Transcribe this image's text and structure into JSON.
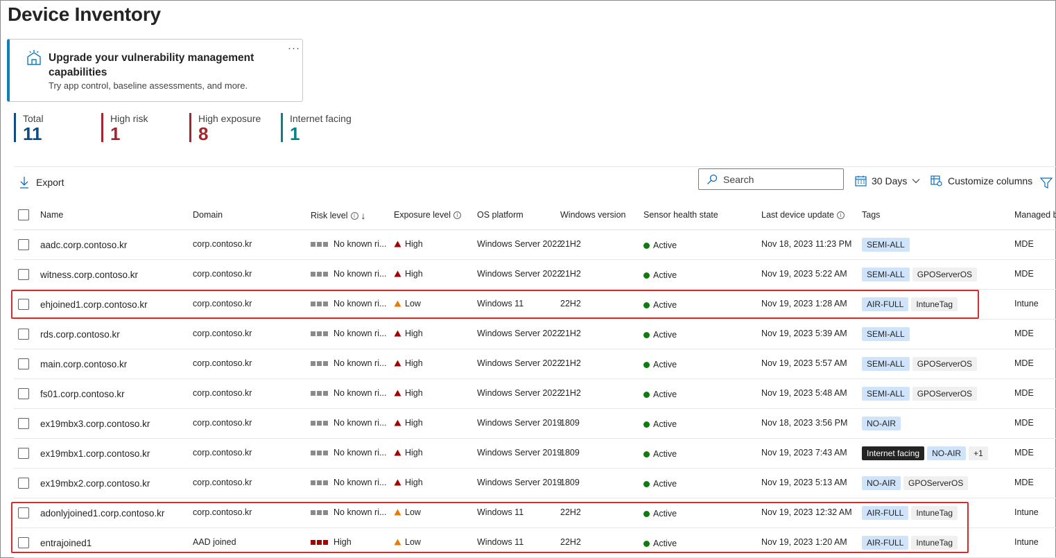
{
  "page": {
    "title": "Device Inventory"
  },
  "card": {
    "title": "Upgrade your vulnerability management capabilities",
    "subtitle": "Try app control, baseline assessments, and more.",
    "more": "···"
  },
  "stats": [
    {
      "label": "Total",
      "value": "11",
      "color": "#0f4c81"
    },
    {
      "label": "High risk",
      "value": "1",
      "color": "#a4262c"
    },
    {
      "label": "High exposure",
      "value": "8",
      "color": "#a4262c"
    },
    {
      "label": "Internet facing",
      "value": "1",
      "color": "#038387"
    }
  ],
  "toolbar": {
    "export_label": "Export",
    "search_placeholder": "Search",
    "days_label": "30 Days",
    "customize_label": "Customize columns"
  },
  "columns": {
    "name": "Name",
    "domain": "Domain",
    "risk": "Risk level",
    "exposure": "Exposure level",
    "os": "OS platform",
    "winver": "Windows version",
    "health": "Sensor health state",
    "lastupdate": "Last device update",
    "tags": "Tags",
    "managed": "Managed b"
  },
  "rows": [
    {
      "name": "aadc.corp.contoso.kr",
      "domain": "corp.contoso.kr",
      "risk": "No known ri...",
      "risk_high": false,
      "exposure": "High",
      "os": "Windows Server 2022",
      "winver": "21H2",
      "health": "Active",
      "updated": "Nov 18, 2023 11:23 PM",
      "tags": [
        {
          "t": "SEMI-ALL",
          "s": "blue"
        }
      ],
      "managed": "MDE"
    },
    {
      "name": "witness.corp.contoso.kr",
      "domain": "corp.contoso.kr",
      "risk": "No known ri...",
      "risk_high": false,
      "exposure": "High",
      "os": "Windows Server 2022",
      "winver": "21H2",
      "health": "Active",
      "updated": "Nov 19, 2023 5:22 AM",
      "tags": [
        {
          "t": "SEMI-ALL",
          "s": "blue"
        },
        {
          "t": "GPOServerOS",
          "s": "gray"
        }
      ],
      "managed": "MDE"
    },
    {
      "name": "ehjoined1.corp.contoso.kr",
      "domain": "corp.contoso.kr",
      "risk": "No known ri...",
      "risk_high": false,
      "exposure": "Low",
      "os": "Windows 11",
      "winver": "22H2",
      "health": "Active",
      "updated": "Nov 19, 2023 1:28 AM",
      "tags": [
        {
          "t": "AIR-FULL",
          "s": "blue"
        },
        {
          "t": "IntuneTag",
          "s": "gray"
        }
      ],
      "managed": "Intune"
    },
    {
      "name": "rds.corp.contoso.kr",
      "domain": "corp.contoso.kr",
      "risk": "No known ri...",
      "risk_high": false,
      "exposure": "High",
      "os": "Windows Server 2022",
      "winver": "21H2",
      "health": "Active",
      "updated": "Nov 19, 2023 5:39 AM",
      "tags": [
        {
          "t": "SEMI-ALL",
          "s": "blue"
        }
      ],
      "managed": "MDE"
    },
    {
      "name": "main.corp.contoso.kr",
      "domain": "corp.contoso.kr",
      "risk": "No known ri...",
      "risk_high": false,
      "exposure": "High",
      "os": "Windows Server 2022",
      "winver": "21H2",
      "health": "Active",
      "updated": "Nov 19, 2023 5:57 AM",
      "tags": [
        {
          "t": "SEMI-ALL",
          "s": "blue"
        },
        {
          "t": "GPOServerOS",
          "s": "gray"
        }
      ],
      "managed": "MDE"
    },
    {
      "name": "fs01.corp.contoso.kr",
      "domain": "corp.contoso.kr",
      "risk": "No known ri...",
      "risk_high": false,
      "exposure": "High",
      "os": "Windows Server 2022",
      "winver": "21H2",
      "health": "Active",
      "updated": "Nov 19, 2023 5:48 AM",
      "tags": [
        {
          "t": "SEMI-ALL",
          "s": "blue"
        },
        {
          "t": "GPOServerOS",
          "s": "gray"
        }
      ],
      "managed": "MDE"
    },
    {
      "name": "ex19mbx3.corp.contoso.kr",
      "domain": "corp.contoso.kr",
      "risk": "No known ri...",
      "risk_high": false,
      "exposure": "High",
      "os": "Windows Server 2019",
      "winver": "1809",
      "health": "Active",
      "updated": "Nov 18, 2023 3:56 PM",
      "tags": [
        {
          "t": "NO-AIR",
          "s": "blue"
        }
      ],
      "managed": "MDE"
    },
    {
      "name": "ex19mbx1.corp.contoso.kr",
      "domain": "corp.contoso.kr",
      "risk": "No known ri...",
      "risk_high": false,
      "exposure": "High",
      "os": "Windows Server 2019",
      "winver": "1809",
      "health": "Active",
      "updated": "Nov 19, 2023 7:43 AM",
      "tags": [
        {
          "t": "Internet facing",
          "s": "dark"
        },
        {
          "t": "NO-AIR",
          "s": "blue"
        },
        {
          "t": "+1",
          "s": "gray"
        }
      ],
      "managed": "MDE"
    },
    {
      "name": "ex19mbx2.corp.contoso.kr",
      "domain": "corp.contoso.kr",
      "risk": "No known ri...",
      "risk_high": false,
      "exposure": "High",
      "os": "Windows Server 2019",
      "winver": "1809",
      "health": "Active",
      "updated": "Nov 19, 2023 5:13 AM",
      "tags": [
        {
          "t": "NO-AIR",
          "s": "blue"
        },
        {
          "t": "GPOServerOS",
          "s": "gray"
        }
      ],
      "managed": "MDE"
    },
    {
      "name": "adonlyjoined1.corp.contoso.kr",
      "domain": "corp.contoso.kr",
      "risk": "No known ri...",
      "risk_high": false,
      "exposure": "Low",
      "os": "Windows 11",
      "winver": "22H2",
      "health": "Active",
      "updated": "Nov 19, 2023 12:32 AM",
      "tags": [
        {
          "t": "AIR-FULL",
          "s": "blue"
        },
        {
          "t": "IntuneTag",
          "s": "gray"
        }
      ],
      "managed": "Intune"
    },
    {
      "name": "entrajoined1",
      "domain": "AAD joined",
      "risk": "High",
      "risk_high": true,
      "exposure": "Low",
      "os": "Windows 11",
      "winver": "22H2",
      "health": "Active",
      "updated": "Nov 19, 2023 1:20 AM",
      "tags": [
        {
          "t": "AIR-FULL",
          "s": "blue"
        },
        {
          "t": "IntuneTag",
          "s": "gray"
        }
      ],
      "managed": "Intune"
    }
  ],
  "colors": {
    "accent": "#0f7ebf",
    "highlight": "#d62c2c",
    "active": "#107c10",
    "high": "#a80000",
    "low": "#e97c00"
  }
}
